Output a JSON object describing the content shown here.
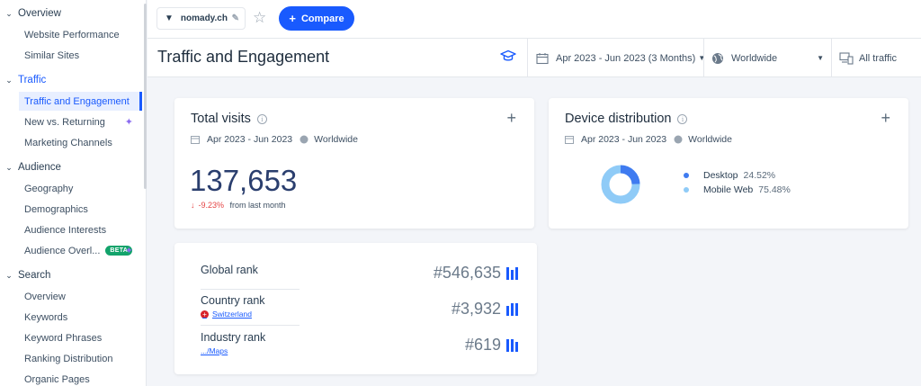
{
  "sidebar": {
    "sections": [
      {
        "label": "Overview",
        "items": [
          "Website Performance",
          "Similar Sites"
        ]
      },
      {
        "label": "Traffic",
        "items": [
          "Traffic and Engagement",
          "New vs. Returning",
          "Marketing Channels"
        ]
      },
      {
        "label": "Audience",
        "items": [
          "Geography",
          "Demographics",
          "Audience Interests",
          "Audience Overl..."
        ]
      },
      {
        "label": "Search",
        "items": [
          "Overview",
          "Keywords",
          "Keyword Phrases",
          "Ranking Distribution",
          "Organic Pages"
        ]
      }
    ],
    "beta_badge": "BETA"
  },
  "topbar": {
    "domain": "nomady.ch",
    "compare_label": "Compare"
  },
  "header": {
    "title": "Traffic and Engagement",
    "date_range": "Apr 2023 - Jun 2023 (3 Months)",
    "region": "Worldwide",
    "traffic": "All traffic"
  },
  "total_visits": {
    "title": "Total visits",
    "date": "Apr 2023 - Jun 2023",
    "region": "Worldwide",
    "value": "137,653",
    "change": "-9.23%",
    "change_suffix": "from last month"
  },
  "device_distribution": {
    "title": "Device distribution",
    "date": "Apr 2023 - Jun 2023",
    "region": "Worldwide",
    "devices": [
      {
        "name": "Desktop",
        "pct": "24.52%",
        "value": 24.52,
        "color": "#3f7bf0"
      },
      {
        "name": "Mobile Web",
        "pct": "75.48%",
        "value": 75.48,
        "color": "#8fcbf7"
      }
    ]
  },
  "ranks": {
    "global_label": "Global rank",
    "global_value": "#546,635",
    "country_label": "Country rank",
    "country_sub": "Switzerland",
    "country_value": "#3,932",
    "industry_label": "Industry rank",
    "industry_sub": ".../Maps",
    "industry_value": "#619"
  },
  "colors": {
    "accent": "#195afe",
    "negative": "#e54545",
    "beta": "#13a36b"
  }
}
